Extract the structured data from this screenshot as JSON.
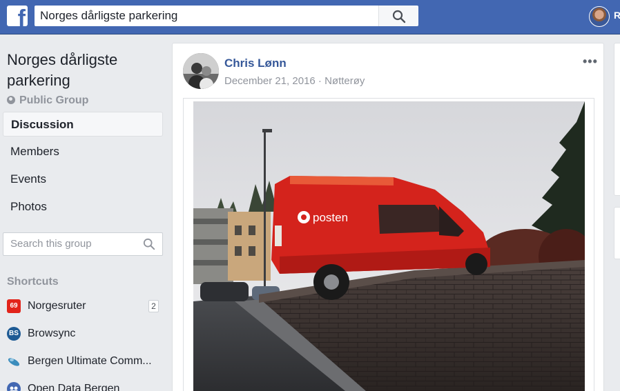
{
  "topbar": {
    "search_value": "Norges dårligste parkering",
    "user_initial": "R"
  },
  "group": {
    "title": "Norges dårligste parkering",
    "privacy": "Public Group"
  },
  "nav": {
    "items": [
      {
        "label": "Discussion",
        "active": true
      },
      {
        "label": "Members",
        "active": false
      },
      {
        "label": "Events",
        "active": false
      },
      {
        "label": "Photos",
        "active": false
      }
    ]
  },
  "group_search": {
    "placeholder": "Search this group"
  },
  "shortcuts": {
    "title": "Shortcuts",
    "items": [
      {
        "label": "Norgesruter",
        "icon": "norgesruter-icon",
        "icon_text": "69",
        "color": "#e2231a",
        "badge": "2"
      },
      {
        "label": "Browsync",
        "icon": "browsync-icon",
        "icon_text": "BS",
        "color": "#1e5a94",
        "badge": ""
      },
      {
        "label": "Bergen Ultimate Comm...",
        "icon": "frisbee-icon",
        "icon_text": "",
        "color": "#3b8dbd",
        "badge": ""
      },
      {
        "label": "Open Data Bergen",
        "icon": "group-icon",
        "icon_text": "",
        "color": "#4267b2",
        "badge": ""
      }
    ]
  },
  "post": {
    "author": "Chris Lønn",
    "date": "December 21, 2016",
    "separator": " · ",
    "location": "Nøtterøy",
    "more": "•••",
    "van_brand": "posten"
  },
  "colors": {
    "topbar": "#4267b2",
    "link": "#365899",
    "muted": "#90949c",
    "background": "#e9ebee"
  }
}
